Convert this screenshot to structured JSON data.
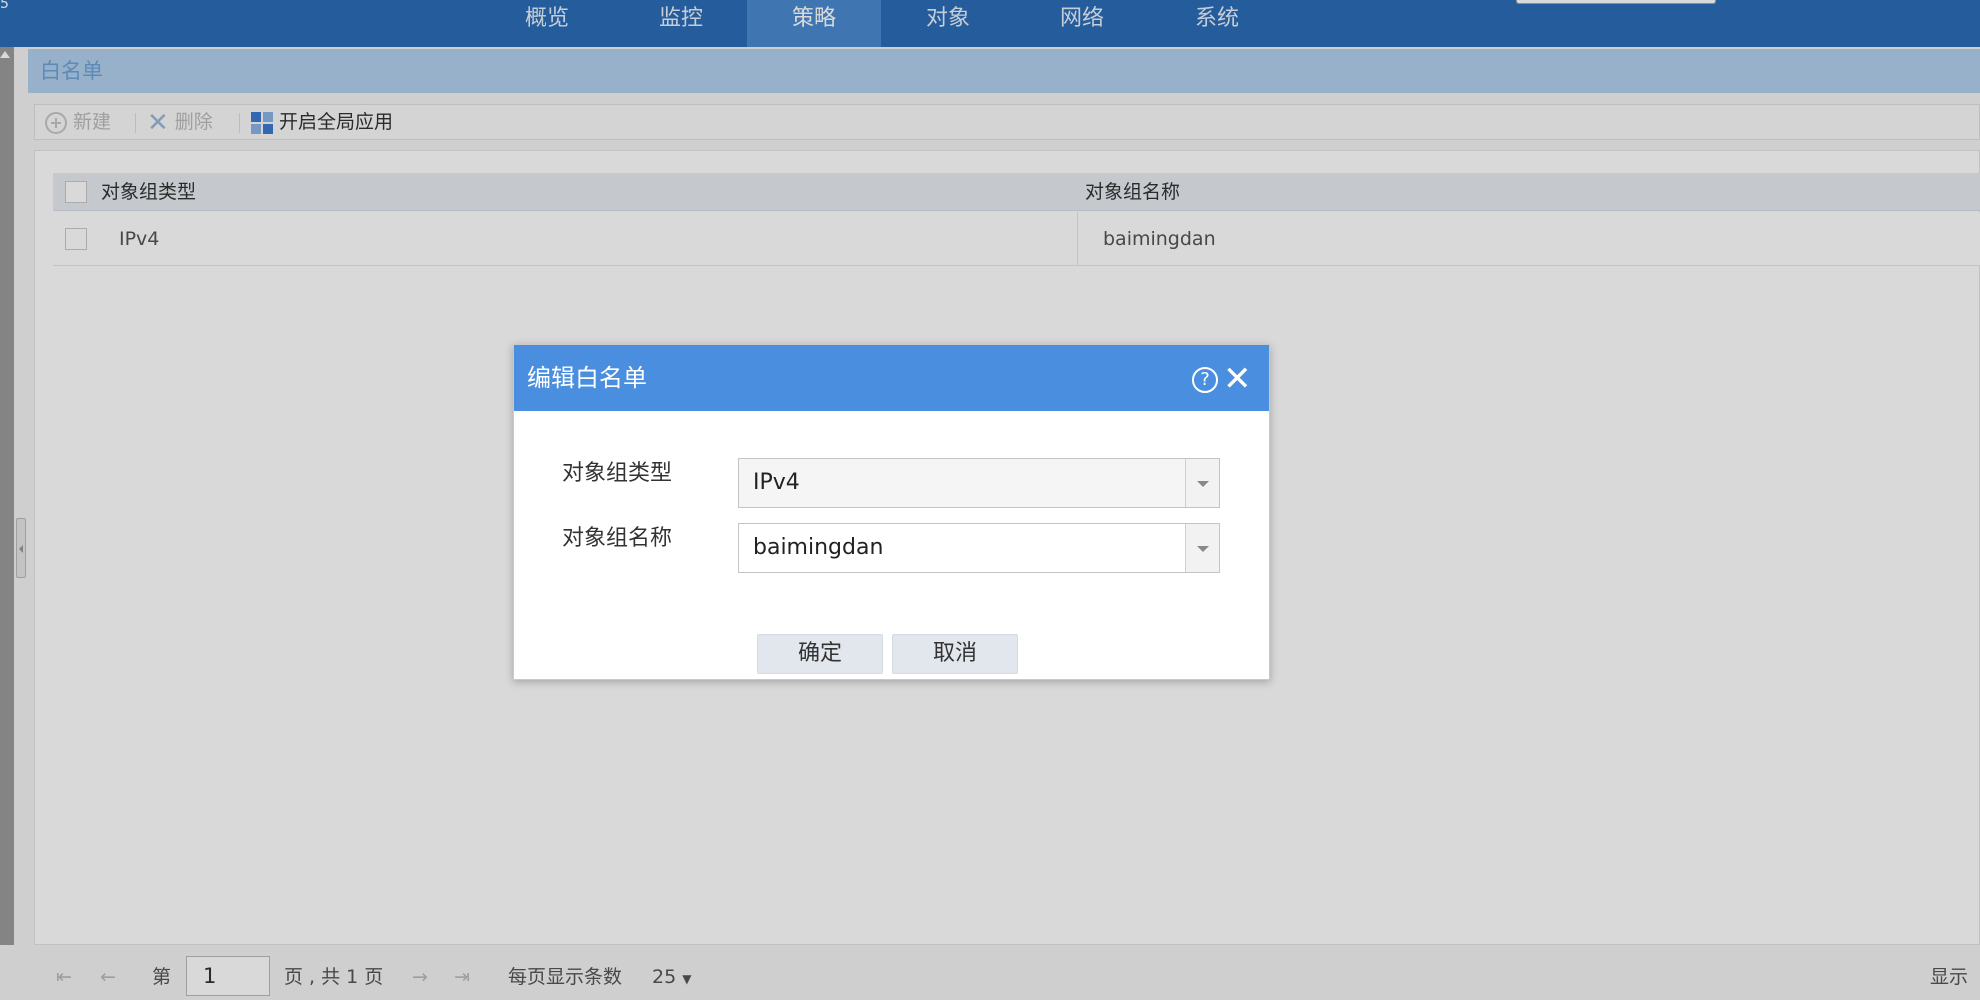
{
  "topnav": {
    "corner_text": "5",
    "tabs": [
      {
        "label": "概览"
      },
      {
        "label": "监控"
      },
      {
        "label": "策略"
      },
      {
        "label": "对象"
      },
      {
        "label": "网络"
      },
      {
        "label": "系统"
      }
    ],
    "active_tab": "策略"
  },
  "panel": {
    "title": "白名单"
  },
  "toolbar": {
    "new_label": "新建",
    "delete_label": "删除",
    "global_apply_label": "开启全局应用"
  },
  "grid": {
    "columns": [
      "对象组类型",
      "对象组名称"
    ],
    "rows": [
      {
        "type": "IPv4",
        "name": "baimingdan"
      }
    ]
  },
  "pager": {
    "page_prefix": "第",
    "current_page": "1",
    "page_suffix": "页 , 共 1 页",
    "page_size_label": "每页显示条数",
    "page_size": "25",
    "display_label": "显示"
  },
  "dialog": {
    "title": "编辑白名单",
    "help_glyph": "?",
    "close_glyph": "✕",
    "fields": [
      {
        "label": "对象组类型",
        "value": "IPv4"
      },
      {
        "label": "对象组名称",
        "value": "baimingdan"
      }
    ],
    "ok_label": "确定",
    "cancel_label": "取消"
  }
}
